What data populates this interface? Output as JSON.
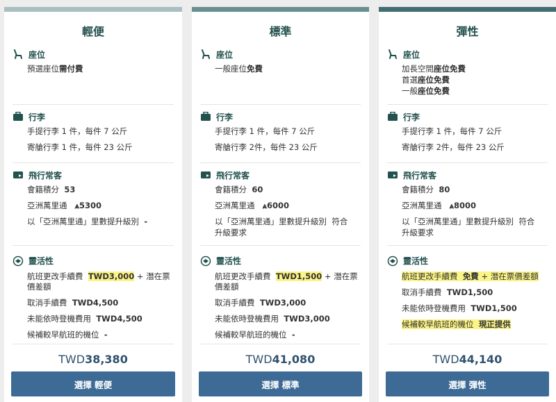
{
  "colors": {
    "bar": [
      "#a9bfc1",
      "#6a8f92",
      "#406e71"
    ],
    "title": "#22514e",
    "button": "#3d6b95",
    "highlight": "#fbf486"
  },
  "fares": [
    {
      "name": "輕便",
      "seat": {
        "heading": "座位",
        "lines": [
          {
            "pre": "預選座位",
            "bold": "需付費"
          }
        ]
      },
      "baggage": {
        "heading": "行李",
        "carry": "手提行李  1 件，每件 7 公斤",
        "checked": "寄艙行李  1 件，每件 23 公斤"
      },
      "ff": {
        "heading": "飛行常客",
        "points_label": "會籍積分",
        "points": "53",
        "miles_label": "亞洲萬里通",
        "miles": "⩓5300",
        "upgrade_label": "以「亞洲萬里通」里數提升級別",
        "upgrade": "-"
      },
      "flex": {
        "heading": "靈活性",
        "change_label": "航班更改手續費",
        "change_value": "TWD3,000",
        "change_suffix": "+ 潛在票",
        "change_suffix2": "價差額",
        "cancel_label": "取消手續費",
        "cancel_value": "TWD4,500",
        "noshow_label": "未能依時登機費用",
        "noshow_value": "TWD4,500",
        "standby_label": "候補較早航班的機位",
        "standby_value": "-"
      },
      "price_cur": "TWD",
      "price_amt": "38,380",
      "button": "選擇 輕便"
    },
    {
      "name": "標準",
      "seat": {
        "heading": "座位",
        "lines": [
          {
            "pre": "一般座位",
            "bold": "免費"
          }
        ]
      },
      "baggage": {
        "heading": "行李",
        "carry": "手提行李  1 件，每件 7 公斤",
        "checked": "寄艙行李  2件，每件 23 公斤"
      },
      "ff": {
        "heading": "飛行常客",
        "points_label": "會籍積分",
        "points": "60",
        "miles_label": "亞洲萬里通",
        "miles": "⩓6000",
        "upgrade_label": "以「亞洲萬里通」里數提升級別",
        "upgrade": "符合",
        "upgrade2": "升級要求"
      },
      "flex": {
        "heading": "靈活性",
        "change_label": "航班更改手續費",
        "change_value": "TWD1,500",
        "change_suffix": "+ 潛在票",
        "change_suffix2": "價差額",
        "cancel_label": "取消手續費",
        "cancel_value": "TWD3,000",
        "noshow_label": "未能依時登機費用",
        "noshow_value": "TWD3,000",
        "standby_label": "候補較早航班的機位",
        "standby_value": "-"
      },
      "price_cur": "TWD",
      "price_amt": "41,080",
      "button": "選擇 標準"
    },
    {
      "name": "彈性",
      "seat": {
        "heading": "座位",
        "lines": [
          {
            "pre": "加長空間",
            "bold": "座位免費"
          },
          {
            "pre": "首選",
            "bold": "座位免費"
          },
          {
            "pre": "一般",
            "bold": "座位免費"
          }
        ]
      },
      "baggage": {
        "heading": "行李",
        "carry": "手提行李  1 件，每件 7 公斤",
        "checked": "寄艙行李  2件，每件 23 公斤"
      },
      "ff": {
        "heading": "飛行常客",
        "points_label": "會籍積分",
        "points": "80",
        "miles_label": "亞洲萬里通",
        "miles": "⩓8000",
        "upgrade_label": "以「亞洲萬里通」里數提升級別",
        "upgrade": "符合",
        "upgrade2": "升級要求"
      },
      "flex": {
        "heading": "靈活性",
        "change_label": "航班更改手續費",
        "change_value": "免費",
        "change_suffix": "+ 潛在票價差額",
        "cancel_label": "取消手續費",
        "cancel_value": "TWD1,500",
        "noshow_label": "未能依時登機費用",
        "noshow_value": "TWD1,500",
        "standby_label": "候補較早航班的機位",
        "standby_value": "現正提供"
      },
      "price_cur": "TWD",
      "price_amt": "44,140",
      "button": "選擇 彈性"
    }
  ]
}
